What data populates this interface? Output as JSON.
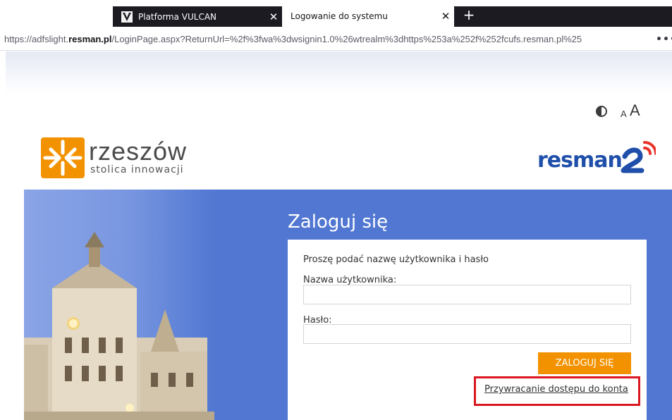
{
  "browser": {
    "tabs": [
      {
        "title": "Platforma VULCAN",
        "active": false
      },
      {
        "title": "Logowanie do systemu",
        "active": true
      }
    ],
    "close_glyph": "✕",
    "new_tab_glyph": "+",
    "url": {
      "prefix": "https://adfslight.",
      "host": "resman.pl",
      "rest": "/LoginPage.aspx?ReturnUrl=%2f%3fwa%3dwsignin1.0%26wtrealm%3dhttps%253a%252f%252fcufs.resman.pl%25"
    },
    "menu_glyph": "•••"
  },
  "accessibility": {
    "contrast_icon": "contrast-icon",
    "font_small": "A",
    "font_large": "A"
  },
  "brand": {
    "city_name": "rzeszów",
    "city_tagline": "stolica innowacji",
    "app_name_main": "resman",
    "colors": {
      "city_orange": "#f39200",
      "resman_blue": "#1f4faa",
      "resman_red": "#e8342b",
      "banner_blue": "#5177d2"
    }
  },
  "login": {
    "heading": "Zaloguj się",
    "prompt": "Proszę podać nazwę użytkownika i hasło",
    "username_label": "Nazwa użytkownika:",
    "username_value": "",
    "password_label": "Hasło:",
    "password_value": "",
    "submit_label": "ZALOGUJ SIĘ",
    "recover_link": "Przywracanie dostępu do konta",
    "highlight_color": "#d9171f"
  }
}
